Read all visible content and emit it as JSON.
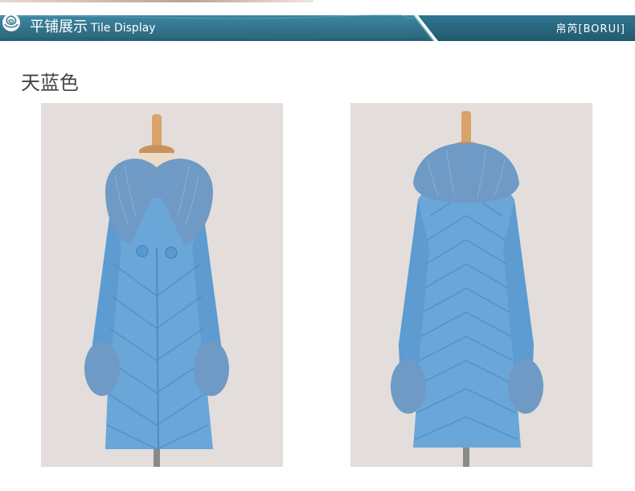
{
  "banner": {
    "title_cn": "平铺展示",
    "title_en": "Tile Display",
    "brand": "帛芮[BORUI]",
    "colors": {
      "dark": "#2f6b80",
      "light": "#3b88a0",
      "wave": "#5aa3b8"
    }
  },
  "section": {
    "color_name": "天蓝色"
  },
  "photos": [
    {
      "id": "front",
      "subject": "sky-blue-down-coat-front-view",
      "icon": "coat-front-photo"
    },
    {
      "id": "back",
      "subject": "sky-blue-down-coat-back-view",
      "icon": "coat-back-photo"
    }
  ],
  "palette": {
    "coat": "#6aa6d8",
    "fur": "#6f9ac6",
    "stand": "#d9a36a",
    "backdrop": "#e3dedb"
  }
}
